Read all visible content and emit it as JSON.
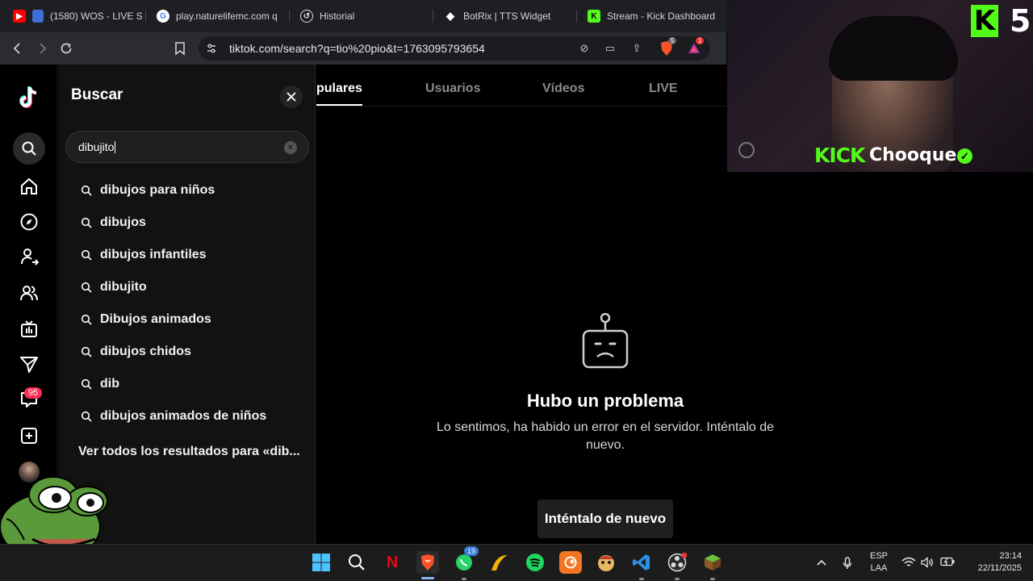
{
  "browser": {
    "tabs": [
      {
        "title": "(1580) WOS - LIVE S",
        "icon": "youtube-icon"
      },
      {
        "title": "play.naturelifemc.com q",
        "icon": "google-icon"
      },
      {
        "title": "Historial",
        "icon": "history-icon"
      },
      {
        "title": "BotRix | TTS Widget",
        "icon": "botrix-icon"
      },
      {
        "title": "Stream - Kick Dashboard",
        "icon": "kick-icon"
      }
    ],
    "url": "tiktok.com/search?q=tio%20pio&t=1763095793654",
    "extension_badges": {
      "brave_shields": "5",
      "alert": "1"
    }
  },
  "tiktok": {
    "rail_badge": "95",
    "search_panel": {
      "title": "Buscar",
      "query": "dibujito",
      "suggestions": [
        "dibujos para niños",
        "dibujos",
        "dibujos infantiles",
        "dibujito",
        "Dibujos animados",
        "dibujos chidos",
        "dib",
        "dibujos animados de niños"
      ],
      "see_all": "Ver todos los resultados para «dib..."
    },
    "content_tabs": {
      "active": "pulares",
      "usuarios": "Usuarios",
      "videos": "Vídeos",
      "live": "LIVE"
    },
    "error": {
      "title": "Hubo un problema",
      "message": "Lo sentimos, ha habido un error en el servidor. Inténtalo de nuevo.",
      "retry": "Inténtalo de nuevo"
    }
  },
  "stream_overlay": {
    "viewer_count": "5",
    "platform": "KICK",
    "username": "Chooque",
    "accent_color": "#53fc18"
  },
  "taskbar": {
    "whatsapp_badge": "19",
    "language": "ESP",
    "layout": "LAA",
    "time": "23:14",
    "date": "22/11/2025"
  }
}
